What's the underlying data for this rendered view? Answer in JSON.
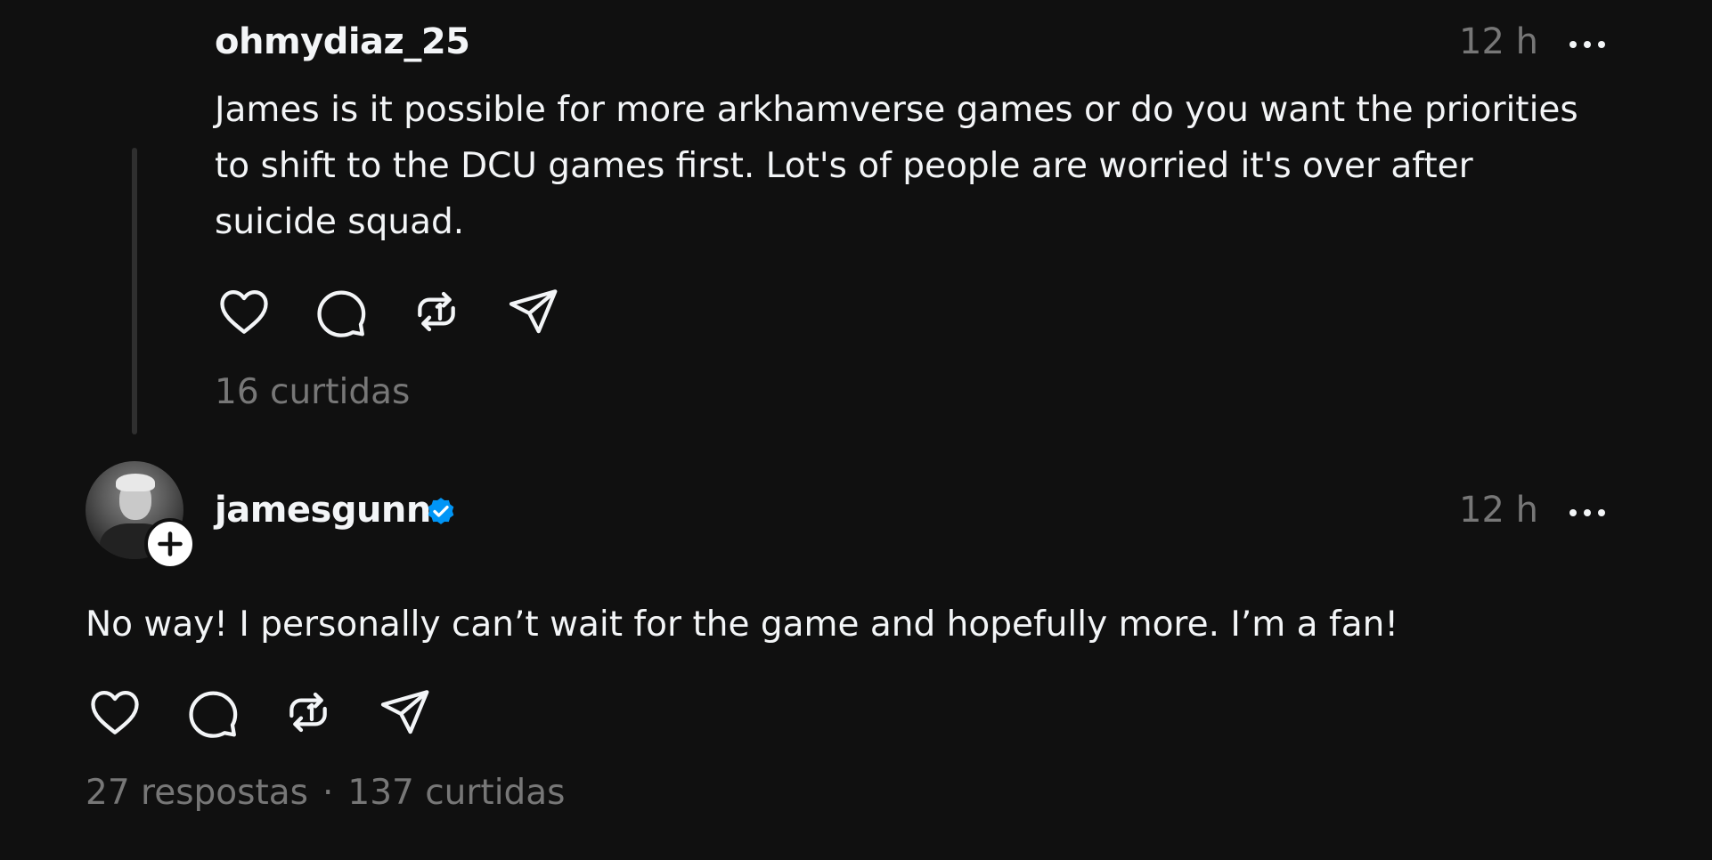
{
  "reply": {
    "username": "ohmydiaz_25",
    "time": "12 h",
    "text_lines": [
      "James is it possible for more arkhamverse games or do you want the priorities",
      "to shift to the DCU games first. Lot's of people are worried it's over after",
      "suicide squad."
    ],
    "likes": "16 curtidas"
  },
  "post": {
    "username": "jamesgunn",
    "verified": true,
    "time": "12 h",
    "text": "No way! I personally can’t wait for the game and hopefully more. I’m a fan!",
    "replies": "27 respostas",
    "separator": "·",
    "likes": "137 curtidas"
  },
  "icons": {
    "like": "heart-icon",
    "comment": "comment-icon",
    "repost": "repost-icon",
    "share": "send-icon",
    "more": "more-horizontal-icon",
    "verified": "verified-badge-icon",
    "follow": "plus-icon"
  },
  "colors": {
    "background": "#101010",
    "text": "#f3f5f7",
    "muted": "#777777",
    "verified": "#0095f6",
    "thread_line": "#2f2f2f"
  }
}
